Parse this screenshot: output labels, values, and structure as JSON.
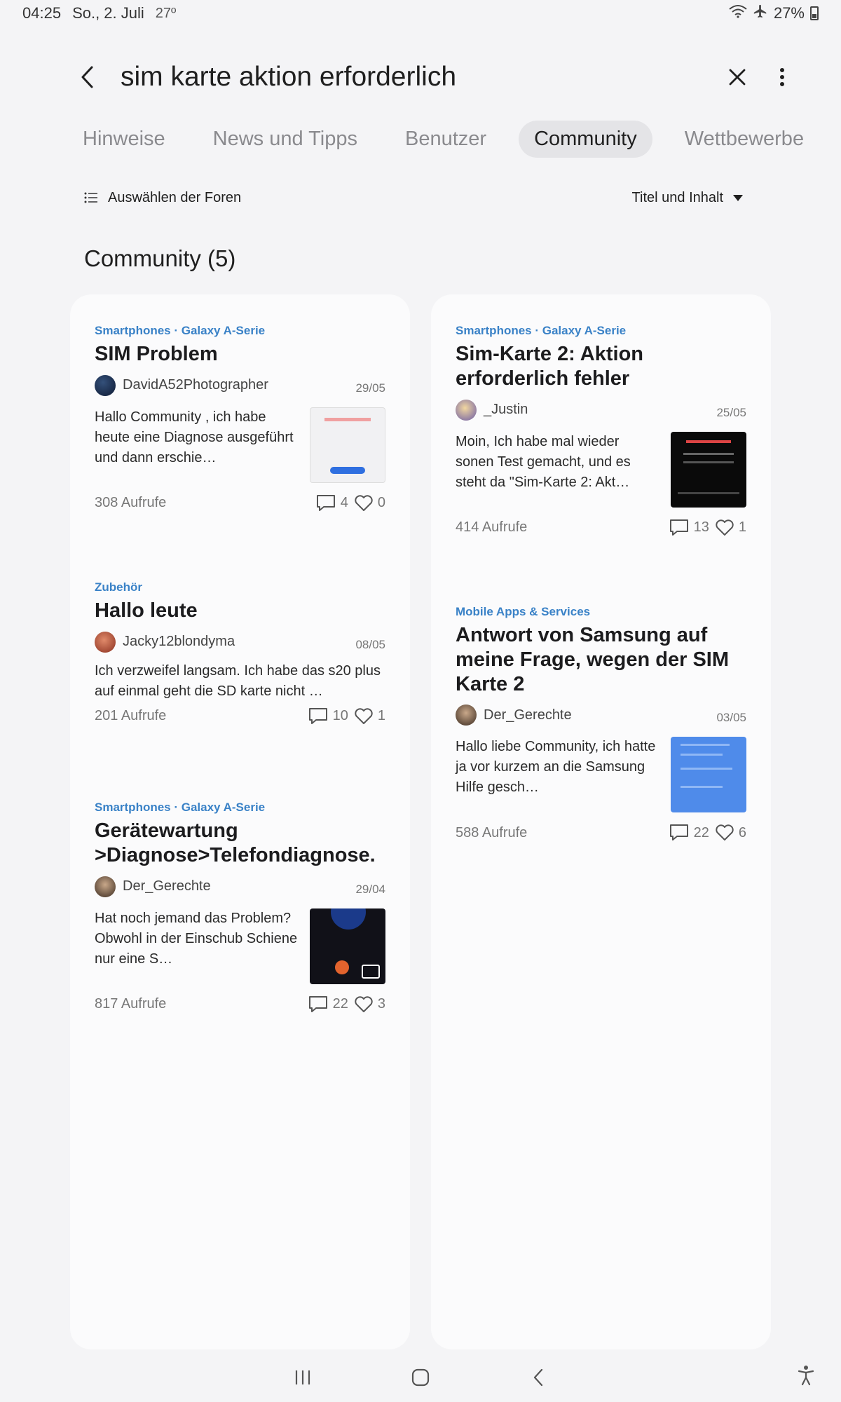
{
  "status_bar": {
    "time": "04:25",
    "date": "So., 2. Juli",
    "temperature": "27º",
    "battery": "27%"
  },
  "search": {
    "query": "sim karte aktion erforderlich"
  },
  "tabs": [
    {
      "label": "Hinweise",
      "active": false
    },
    {
      "label": "News und Tipps",
      "active": false
    },
    {
      "label": "Benutzer",
      "active": false
    },
    {
      "label": "Community",
      "active": true
    },
    {
      "label": "Wettbewerbe",
      "active": false
    }
  ],
  "filters": {
    "forums_label": "Auswählen der Foren",
    "sort_label": "Titel und Inhalt"
  },
  "section": {
    "title": "Community (5)"
  },
  "posts_left": [
    {
      "category": "Smartphones · Galaxy A-Serie",
      "title": "SIM Problem",
      "author": "DavidA52Photographer",
      "date": "29/05",
      "excerpt": "Hallo Community , ich habe heute eine Diagnose ausgeführt und dann erschie…",
      "views": "308 Aufrufe",
      "comments": "4",
      "likes": "0",
      "thumbnail": "light-screenshot",
      "avatar_color": "#1b2a4a"
    },
    {
      "category": "Zubehör",
      "title": "Hallo leute",
      "author": "Jacky12blondyma",
      "date": "08/05",
      "excerpt": "Ich verzweifel langsam. Ich habe das s20 plus auf einmal geht die SD karte nicht …",
      "views": "201 Aufrufe",
      "comments": "10",
      "likes": "1",
      "thumbnail": "",
      "avatar_color": "#c9634a"
    },
    {
      "category": "Smartphones · Galaxy A-Serie",
      "title": "Gerätewartung >Diagnose>Telefondiagnose.",
      "author": "Der_Gerechte",
      "date": "29/04",
      "excerpt": "Hat noch jemand das Problem? Obwohl in der Einschub Schiene nur eine S…",
      "views": "817 Aufrufe",
      "comments": "22",
      "likes": "3",
      "thumbnail": "dark-app-multi",
      "avatar_color": "#5a4a3a"
    }
  ],
  "posts_right": [
    {
      "category": "Smartphones · Galaxy A-Serie",
      "title": "Sim-Karte 2: Aktion erforderlich fehler",
      "author": "_Justin",
      "date": "25/05",
      "excerpt": "Moin, Ich habe mal wieder sonen Test gemacht, und es steht da \"Sim-Karte 2: Akt…",
      "views": "414 Aufrufe",
      "comments": "13",
      "likes": "1",
      "thumbnail": "dark-screenshot",
      "avatar_color": "#8a78b5"
    },
    {
      "category": "Mobile Apps & Services",
      "title": "Antwort von Samsung auf meine Frage, wegen der SIM Karte 2",
      "author": "Der_Gerechte",
      "date": "03/05",
      "excerpt": "Hallo liebe Community, ich hatte ja vor kurzem an die Samsung Hilfe gesch…",
      "views": "588 Aufrufe",
      "comments": "22",
      "likes": "6",
      "thumbnail": "blue-screenshot",
      "avatar_color": "#5a4a3a"
    }
  ],
  "colors": {
    "accent_category": "#3a82c7",
    "background": "#f4f4f6",
    "card": "#fbfbfc",
    "active_tab": "#e4e4e7"
  }
}
